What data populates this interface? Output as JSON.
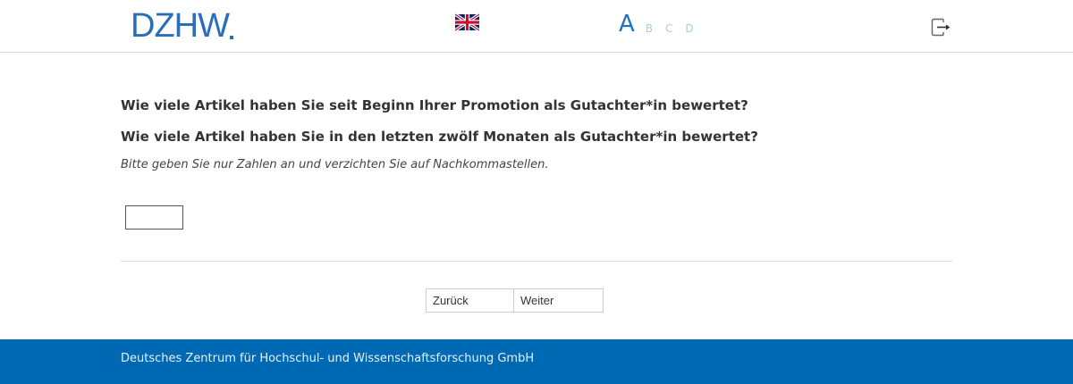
{
  "header": {
    "logo_text": "DZHW",
    "flag_icon": "uk-flag-icon",
    "font_sizes": [
      "A",
      "B",
      "C",
      "D"
    ],
    "active_font_size": "A",
    "logout_icon": "logout-icon"
  },
  "question": {
    "line1": "Wie viele Artikel haben Sie seit Beginn Ihrer Promotion als Gutachter*in bewertet?",
    "line2": "Wie viele Artikel haben Sie in den letzten zwölf Monaten als Gutachter*in bewertet?",
    "hint": "Bitte geben Sie nur Zahlen an und verzichten Sie auf Nachkommastellen.",
    "answer_value": ""
  },
  "nav": {
    "back_label": "Zurück",
    "next_label": "Weiter"
  },
  "footer": {
    "text": "Deutsches Zentrum für Hochschul- und Wissenschaftsforschung GmbH"
  },
  "colors": {
    "brand_blue": "#2a6ebb",
    "footer_blue": "#0069b4",
    "font_size_active": "#1e73be",
    "font_size_inactive": "#a9cbe6"
  }
}
